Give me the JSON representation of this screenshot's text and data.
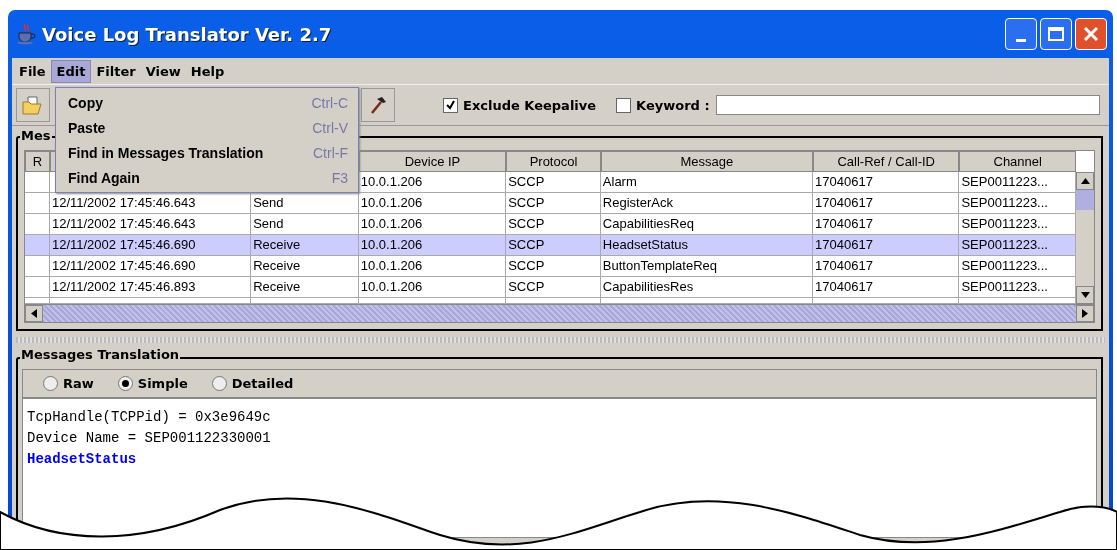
{
  "window": {
    "title": "Voice Log Translator Ver. 2.7"
  },
  "menu_bar": [
    {
      "label": "File",
      "selected": false
    },
    {
      "label": "Edit",
      "selected": true
    },
    {
      "label": "Filter",
      "selected": false
    },
    {
      "label": "View",
      "selected": false
    },
    {
      "label": "Help",
      "selected": false
    }
  ],
  "edit_menu": [
    {
      "label": "Copy",
      "shortcut": "Ctrl-C"
    },
    {
      "label": "Paste",
      "shortcut": "Ctrl-V"
    },
    {
      "label": "Find in Messages Translation",
      "shortcut": "Ctrl-F"
    },
    {
      "label": "Find Again",
      "shortcut": "F3"
    }
  ],
  "toolbar": {
    "exclude_keepalive": {
      "label": "Exclude Keepalive",
      "checked": true
    },
    "keyword": {
      "label": "Keyword :",
      "checked": false
    }
  },
  "messages_panel": {
    "title": "Mes",
    "columns": [
      "R",
      "",
      "",
      "Device IP",
      "Protocol",
      "Message",
      "Call-Ref / Call-ID",
      "Channel"
    ],
    "rows": [
      {
        "selected": false,
        "cells": [
          "",
          "",
          "",
          "10.0.1.206",
          "SCCP",
          "Alarm",
          "17040617",
          "SEP0011223..."
        ]
      },
      {
        "selected": false,
        "cells": [
          "",
          "12/11/2002 17:45:46.643",
          "Send",
          "10.0.1.206",
          "SCCP",
          "RegisterAck",
          "17040617",
          "SEP0011223..."
        ]
      },
      {
        "selected": false,
        "cells": [
          "",
          "12/11/2002 17:45:46.643",
          "Send",
          "10.0.1.206",
          "SCCP",
          "CapabilitiesReq",
          "17040617",
          "SEP0011223..."
        ]
      },
      {
        "selected": true,
        "cells": [
          "",
          "12/11/2002 17:45:46.690",
          "Receive",
          "10.0.1.206",
          "SCCP",
          "HeadsetStatus",
          "17040617",
          "SEP0011223..."
        ]
      },
      {
        "selected": false,
        "cells": [
          "",
          "12/11/2002 17:45:46.690",
          "Receive",
          "10.0.1.206",
          "SCCP",
          "ButtonTemplateReq",
          "17040617",
          "SEP0011223..."
        ]
      },
      {
        "selected": false,
        "cells": [
          "",
          "12/11/2002 17:45:46.893",
          "Receive",
          "10.0.1.206",
          "SCCP",
          "CapabilitiesRes",
          "17040617",
          "SEP0011223..."
        ]
      }
    ]
  },
  "translation_panel": {
    "title": "Messages Translation",
    "modes": [
      {
        "label": "Raw",
        "selected": false
      },
      {
        "label": "Simple",
        "selected": true
      },
      {
        "label": "Detailed",
        "selected": false
      }
    ],
    "lines": [
      {
        "kind": "plain",
        "text": "TcpHandle(TCPPid) = 0x3e9649c"
      },
      {
        "kind": "plain",
        "text": "Device Name = SEP001122330001"
      },
      {
        "kind": "highlight",
        "text": "HeadsetStatus"
      }
    ]
  }
}
